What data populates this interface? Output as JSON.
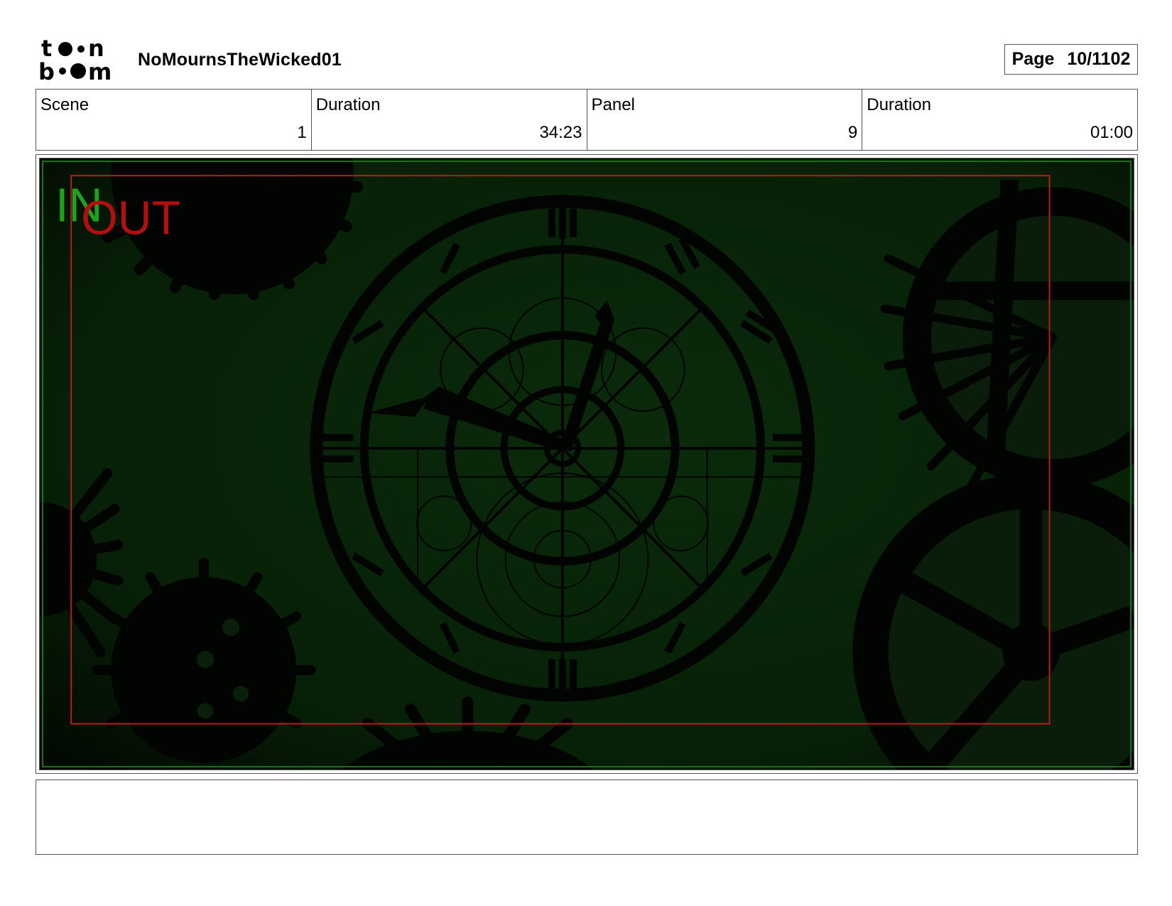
{
  "header": {
    "logo_lines": [
      "toon",
      "boom"
    ],
    "project_title": "NoMournsTheWicked01",
    "page_label": "Page",
    "page_value": "10/1102"
  },
  "info": {
    "scene_label": "Scene",
    "scene_value": "1",
    "scene_duration_label": "Duration",
    "scene_duration_value": "34:23",
    "panel_label": "Panel",
    "panel_value": "9",
    "panel_duration_label": "Duration",
    "panel_duration_value": "01:00"
  },
  "panel": {
    "in_marker": "IN",
    "out_marker": "OUT",
    "colors": {
      "background": "#062006",
      "in_marker": "#1fa31f",
      "out_marker": "#b40f0f",
      "safe_frame": "#b41e1e",
      "camera_frame": "#1f6e1f"
    }
  },
  "notes": {
    "text": ""
  }
}
